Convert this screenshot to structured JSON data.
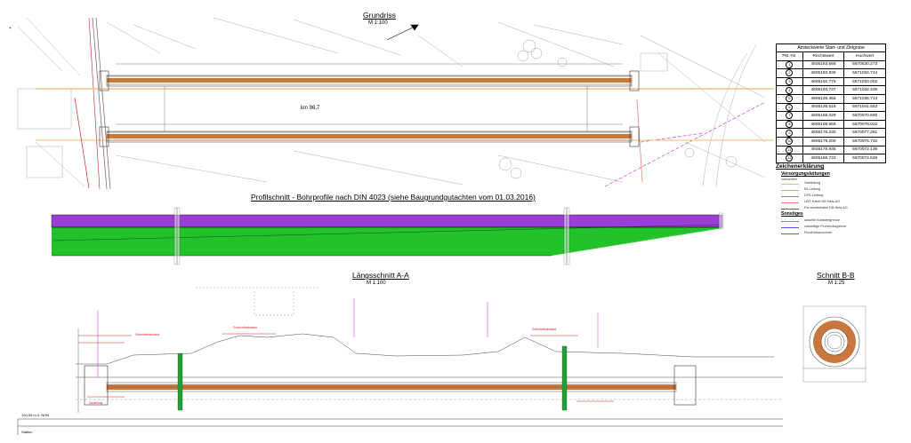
{
  "sections": {
    "grundriss": {
      "title": "Grundriss",
      "scale": "M 1:100"
    },
    "profil": {
      "title": "Profilschnitt - Bohrprofile nach DIN 4023 (siehe Baugrundgutachten vom 01.03.2016)"
    },
    "laengs": {
      "title": "Längsschnitt A-A",
      "scale": "M 1:100"
    },
    "schnitt": {
      "title": "Schnitt B-B",
      "scale": "M 1:25"
    }
  },
  "coord_table": {
    "caption": "Absteckwerte Start- und Zielgrube",
    "headers": [
      "Pkt.-Nr.",
      "Rechtswert",
      "Hochwert"
    ],
    "rows": [
      [
        "1",
        "4605183.566",
        "5670530.273"
      ],
      [
        "2",
        "4605183.936",
        "5671034.744"
      ],
      [
        "3",
        "4605191.776",
        "5671033.002"
      ],
      [
        "4",
        "4605193.737",
        "5671032.435"
      ],
      [
        "5",
        "4605126.456",
        "5671036.713"
      ],
      [
        "6",
        "4605136.516",
        "5671041.553"
      ],
      [
        "7",
        "4605168.029",
        "5670070.600"
      ],
      [
        "8",
        "4605108.566",
        "5670078.022"
      ],
      [
        "9",
        "4605176.230",
        "5670077.281"
      ],
      [
        "10",
        "4605179.200",
        "5670076.732"
      ],
      [
        "11",
        "4605178.935",
        "5670072.136"
      ],
      [
        "12",
        "4605166.733",
        "5670074.646"
      ]
    ]
  },
  "legend": {
    "title": "Zeichenerklärung",
    "versorgung_title": "Versorgungsleitungen",
    "versorgung_note": "vorhanden",
    "versorgung_items": [
      {
        "label": "Gasleitung",
        "color": "#e8b878"
      },
      {
        "label": "Elt-Leitung",
        "color": "#c8a878"
      },
      {
        "label": "DFS-Leitung",
        "color": "#888888"
      },
      {
        "label": "LWT-Kabel DB Netz AG",
        "color": "#f08080"
      },
      {
        "label": "Fernmeldekabel DB Netz AG",
        "color": "#c83030"
      }
    ],
    "sonstige_title": "Sonstiges",
    "sonstige_items": [
      {
        "label": "aktuelle Katastergrenze",
        "color": "#e050e0"
      },
      {
        "label": "zukünftige Flurstücksgrenze",
        "color": "#5050e0"
      },
      {
        "label": "Flurstücksnummer",
        "color": "#6060c0"
      }
    ]
  },
  "grundriss_labels": {
    "km": "km 96,7"
  },
  "colors": {
    "pipe": "#c8783c",
    "pipe_edge": "#7a4a20",
    "soil_top": "#9a3fd6",
    "soil_main": "#22c22a",
    "gas": "#e8b878",
    "red_line": "#d02020",
    "magenta": "#e040e0"
  },
  "station_label": "Station",
  "datum_label": "100,00 m ü. NHN"
}
